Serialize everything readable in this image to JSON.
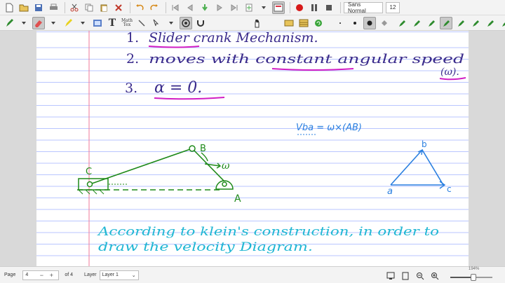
{
  "toolbar": {
    "font_name": "Sans Normal",
    "font_size": "12",
    "math_label_line1": "Math",
    "math_label_line2": "Tex",
    "text_tool_label": "T"
  },
  "notes": {
    "line1_number": "1.",
    "line1_text": "Slider crank Mechanism.",
    "line2_number": "2.",
    "line2_text": "moves with constant angular speed",
    "line2_omega": "(ω).",
    "line3_number": "3.",
    "line3_text": "α = 0.",
    "velocity_equation": "Vba = ω×(AB)",
    "label_b": "B",
    "label_c": "C",
    "label_a": "A",
    "label_omega": "ω",
    "vel_b": "b",
    "vel_a": "a",
    "vel_c": "c",
    "bottom_line1": "According to klein's construction, in order to",
    "bottom_line2": "draw the velocity Diagram."
  },
  "statusbar": {
    "page_label": "Page",
    "page_value": "4",
    "page_of": "of 4",
    "layer_label": "Layer",
    "layer_value": "Layer 1",
    "zoom_label": "194%",
    "zoom_fraction": 0.55
  },
  "colors": {
    "notes_purple": "#3a2b8c",
    "highlight_magenta": "#d21ec4",
    "mechanism_green": "#1f8a1a",
    "ink_cyan": "#1fb6d3",
    "velocity_blue": "#2a7fe0",
    "ruling_blue": "#b9c6ff",
    "margin_red": "#f07a9a",
    "record_red": "#d71a1a"
  }
}
